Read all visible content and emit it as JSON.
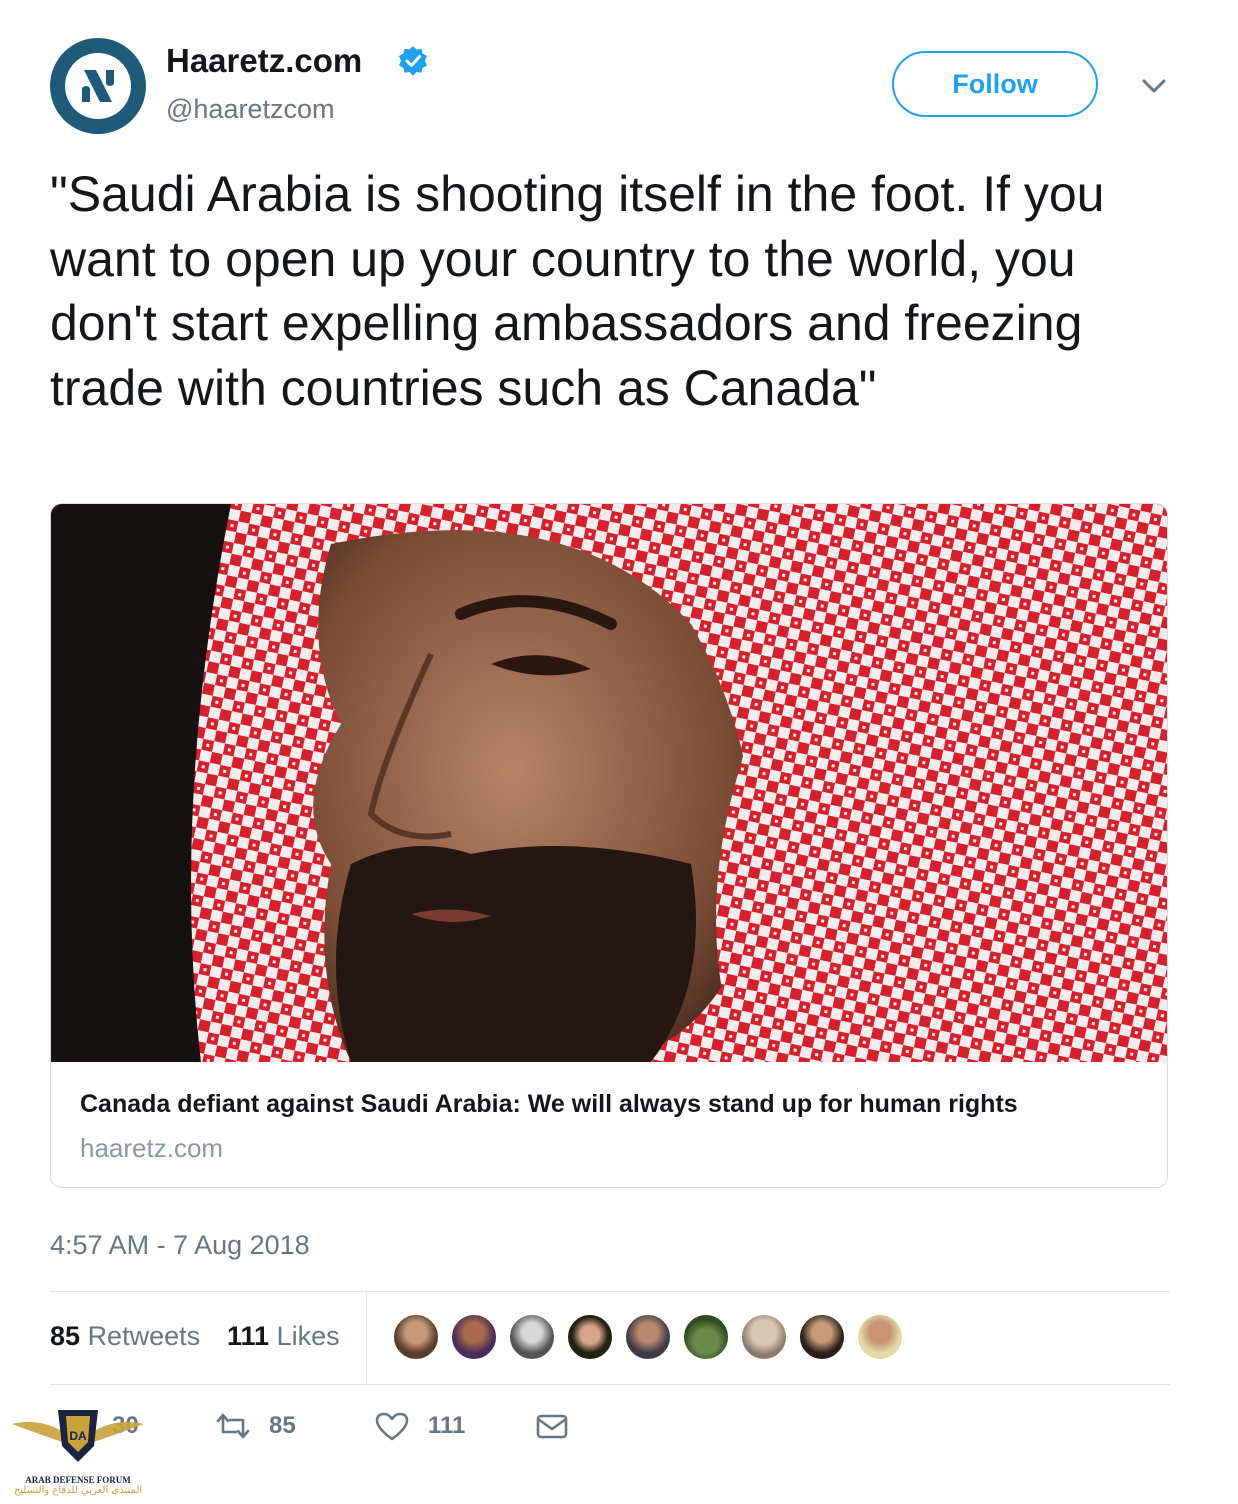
{
  "author": {
    "name": "Haaretz.com",
    "handle": "@haaretzcom",
    "avatar_icon": "haaretz-logo-icon",
    "verified_icon": "verified-badge-icon"
  },
  "follow_button": {
    "label": "Follow",
    "menu_icon": "chevron-down-icon"
  },
  "tweet": {
    "text": "\"Saudi Arabia is shooting itself in the foot. If you want to open up your country to the world, you don't start expelling ambassadors and freezing trade with countries such as Canada\""
  },
  "card": {
    "image_icon": "article-photo",
    "title": "Canada defiant against Saudi Arabia: We will always stand up for human rights",
    "domain": "haaretz.com"
  },
  "timestamp": "4:57 AM - 7 Aug 2018",
  "stats": {
    "retweets_count": "85",
    "retweets_label": "Retweets",
    "likes_count": "111",
    "likes_label": "Likes"
  },
  "likers": [
    "liker-avatar-1",
    "liker-avatar-2",
    "liker-avatar-3",
    "liker-avatar-4",
    "liker-avatar-5",
    "liker-avatar-6",
    "liker-avatar-7",
    "liker-avatar-8",
    "liker-avatar-9"
  ],
  "actions": {
    "reply_count": "30",
    "retweet_count": "85",
    "like_count": "111",
    "reply_icon": "reply-icon",
    "retweet_icon": "retweet-icon",
    "like_icon": "heart-icon",
    "dm_icon": "envelope-icon"
  },
  "watermark": {
    "line1": "ARAB DEFENSE FORUM",
    "line2": "المنتدى العربي للدفاع والتسليح",
    "icon": "arab-defense-forum-logo"
  },
  "colors": {
    "accent": "#1da1f2",
    "text": "#14171a",
    "muted": "#657786",
    "border": "#e1e8ed"
  }
}
